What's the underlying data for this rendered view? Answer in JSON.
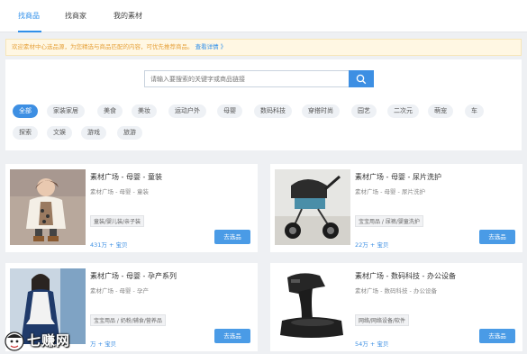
{
  "tabs": [
    {
      "label": "找商品"
    },
    {
      "label": "找商家"
    },
    {
      "label": "我的素材"
    }
  ],
  "notice": {
    "text": "欢迎素材中心选品源，为您精选与商品匹配的内容，可优先推荐商品。",
    "link": "查看详情 》"
  },
  "search": {
    "placeholder": "请输入要搜索的关键字或商品链接"
  },
  "categories": [
    "全部",
    "家装家居",
    "美食",
    "美妆",
    "运动户外",
    "母婴",
    "数码科技",
    "穿搭时尚",
    "园艺",
    "二次元",
    "萌宠",
    "车",
    "探索",
    "文娱",
    "游戏",
    "旅游"
  ],
  "cards": [
    {
      "title": "素材广场 - 母婴 - 童装",
      "path": "素材广场 - 母婴 - 童装",
      "tag": "童装/婴儿装/亲子装",
      "stat": "431万 + 宝贝",
      "button": "去选品"
    },
    {
      "title": "素材广场 - 母婴 - 尿片洗护",
      "path": "素材广场 - 母婴 - 尿片洗护",
      "tag": "宝宝用品 / 尿裤/婴童洗护",
      "stat": "22万 + 宝贝",
      "button": "去选品"
    },
    {
      "title": "素材广场 - 母婴 - 孕产系列",
      "path": "素材广场 - 母婴 - 孕产",
      "tag": "宝宝用品 / 奶粉/辅食/营养品",
      "stat": "万 + 宝贝",
      "button": "去选品"
    },
    {
      "title": "素材广场 - 数码科技 - 办公设备",
      "path": "素材广场 - 数码科技 - 办公设备",
      "tag": "网络/网络设备/软件",
      "stat": "54万 + 宝贝",
      "button": "去选品"
    }
  ],
  "watermark": {
    "text": "七赚网"
  }
}
